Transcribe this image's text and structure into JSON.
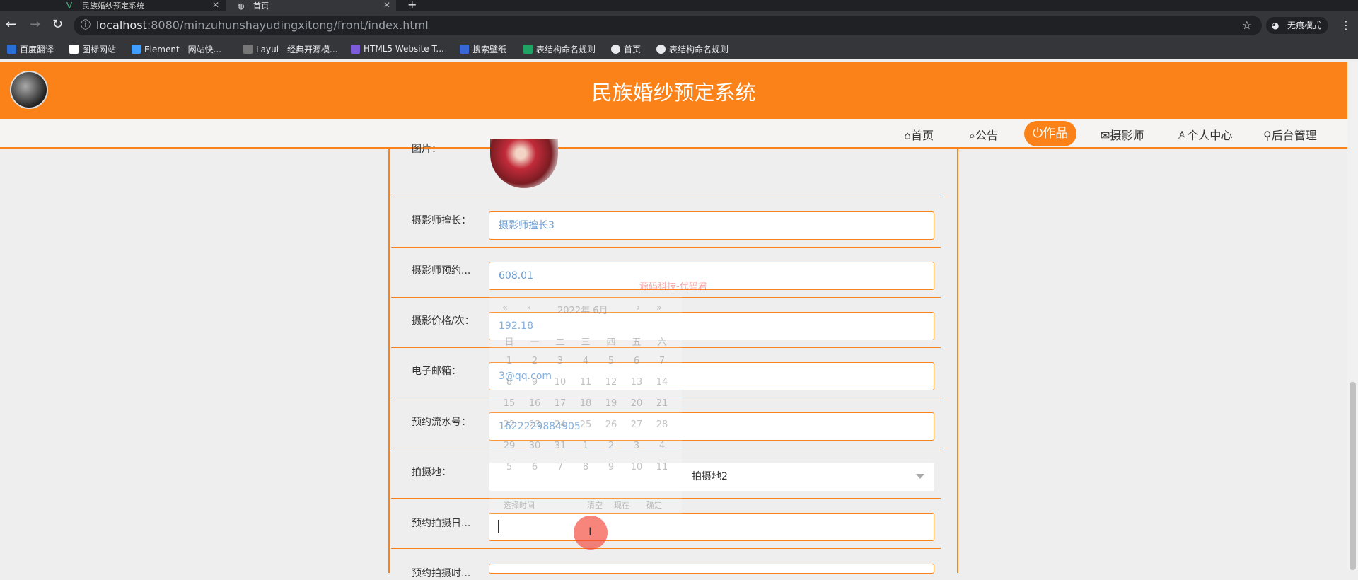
{
  "browser": {
    "tabs": [
      {
        "label": "民族婚纱预定系统",
        "active": false
      },
      {
        "label": "首页",
        "active": true
      }
    ],
    "url_host": "localhost",
    "url_path": ":8080/minzuhunshayudingxitong/front/index.html",
    "profile_label": "无痕模式",
    "bookmarks": [
      "百度翻译",
      "图标网站",
      "Element - 网站快...",
      "Layui - 经典开源模...",
      "HTML5 Website T...",
      "搜索壁纸",
      "表结构命名规则",
      "首页",
      "表结构命名规则"
    ]
  },
  "site": {
    "title": "民族婚纱预定系统",
    "nav": [
      "首页",
      "公告",
      "作品",
      "摄影师",
      "个人中心",
      "后台管理"
    ],
    "active_nav": "作品"
  },
  "form": {
    "image_label": "图片：",
    "fields": [
      {
        "label": "摄影师擅长：",
        "value": "摄影师擅长3"
      },
      {
        "label": "摄影师预约...",
        "value": "608.01"
      },
      {
        "label": "摄影价格/次：",
        "value": "192.18"
      },
      {
        "label": "电子邮箱：",
        "value": "3@qq.com"
      },
      {
        "label": "预约流水号：",
        "value": "1622229884905"
      }
    ],
    "location_label": "拍摄地：",
    "location_value": "拍摄地2",
    "date_label": "预约拍摄日...",
    "date_value": "",
    "next_label": "预约拍摄时..."
  },
  "datepicker": {
    "header": "2022年 6月",
    "weekdays": [
      "日",
      "一",
      "二",
      "三",
      "四",
      "五",
      "六"
    ],
    "weeks": [
      [
        "1",
        "2",
        "3",
        "4",
        "5",
        "6",
        "7"
      ],
      [
        "8",
        "9",
        "10",
        "11",
        "12",
        "13",
        "14"
      ],
      [
        "15",
        "16",
        "17",
        "18",
        "19",
        "20",
        "21"
      ],
      [
        "22",
        "23",
        "24",
        "25",
        "26",
        "27",
        "28"
      ],
      [
        "29",
        "30",
        "31",
        "1",
        "2",
        "3",
        "4"
      ],
      [
        "5",
        "6",
        "7",
        "8",
        "9",
        "10",
        "11"
      ]
    ],
    "footer": [
      "选择时间",
      "清空",
      "现在",
      "确定"
    ]
  },
  "watermark": "源码科技-代码君",
  "colors": {
    "accent": "#fa8219",
    "link": "#6a9ed4"
  }
}
